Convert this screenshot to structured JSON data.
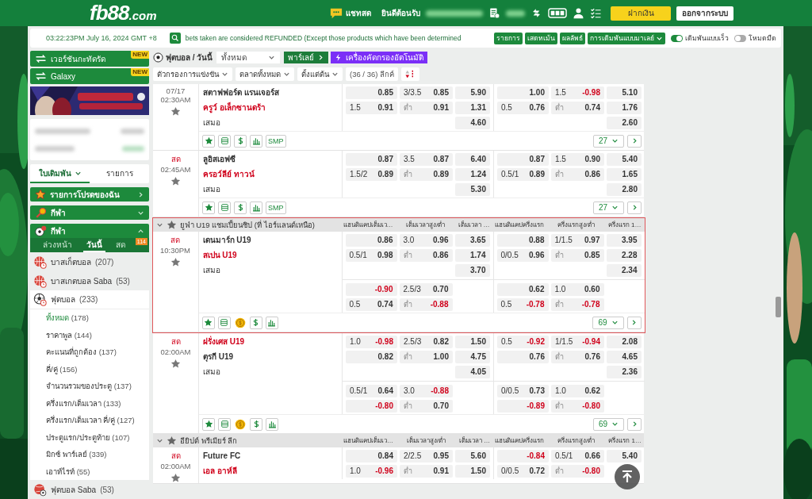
{
  "header": {
    "logo_main": "fb88",
    "logo_suffix": ".com",
    "chat": "แชทสด",
    "welcome": "ยินดีต้อนรับ",
    "deposit": "ฝากเงิน",
    "logout": "ออกจากระบบ"
  },
  "topbar": {
    "clock": "03:22:23PM July 16, 2024 GMT +8",
    "notice": "bets taken are considered REFUNDED (Except those products which have been determined",
    "links": [
      "รายการ",
      "เสตทเม้น",
      "ผลลัพธ์"
    ],
    "odds_type": "การเดิมพันแบบมาเลย์",
    "toggles": [
      {
        "label": "เดิมพันแบบเร็ว",
        "on": true
      },
      {
        "label": "โหมดมืด",
        "on": false
      }
    ]
  },
  "sidebar": {
    "promos": [
      {
        "label": "เวอร์ชันกะทัดรัด",
        "badge": "NEW"
      },
      {
        "label": "Galaxy",
        "badge": "NEW"
      }
    ],
    "slip_tabs": [
      {
        "label": "ใบเดิมพัน",
        "selected": true
      },
      {
        "label": "รายการ",
        "selected": false
      }
    ],
    "sections": [
      {
        "kind": "favorites",
        "label": "รายการโปรดของฉัน",
        "expanded": false
      },
      {
        "kind": "sports",
        "label": "กีฬา",
        "expanded": false
      },
      {
        "kind": "sports",
        "label": "กีฬา",
        "expanded": true
      }
    ],
    "periods": [
      {
        "label": "ล่วงหน้า",
        "selected": false
      },
      {
        "label": "วันนี้",
        "selected": true
      },
      {
        "label": "สด",
        "selected": false,
        "badge": "114"
      }
    ],
    "sports": [
      {
        "kind": "basketball",
        "label": "บาสเก็ตบอล",
        "count": "(207)",
        "expanded": false
      },
      {
        "kind": "basketball",
        "label": "บาสเกตบอล Saba",
        "count": "(53)",
        "expanded": false
      },
      {
        "kind": "soccer",
        "label": "ฟุตบอล",
        "count": "(233)",
        "expanded": true,
        "children": [
          {
            "label": "ทั้งหมด",
            "count": "(178)",
            "selected": true
          },
          {
            "label": "ราคาพูล",
            "count": "(144)",
            "selected": false
          },
          {
            "label": "คะแนนที่ถูกต้อง",
            "count": "(137)",
            "selected": false
          },
          {
            "label": "คี่/คู่",
            "count": "(156)",
            "selected": false
          },
          {
            "label": "จำนวนรวมของประตู",
            "count": "(137)",
            "selected": false
          },
          {
            "label": "ครึ่งแรก/เต็มเวลา",
            "count": "(133)",
            "selected": false
          },
          {
            "label": "ครึ่งแรก/เต็มเวลา คี่/คู่",
            "count": "(127)",
            "selected": false
          },
          {
            "label": "ประตูแรก/ประตูท้าย",
            "count": "(107)",
            "selected": false
          },
          {
            "label": "มิกซ์ พาร์เลย์",
            "count": "(339)",
            "selected": false
          },
          {
            "label": "เอาท์ไรท์",
            "count": "(55)",
            "selected": false
          }
        ]
      },
      {
        "kind": "saba-soccer",
        "label": "ฟุตบอล Saba",
        "count": "(53)",
        "expanded": false
      }
    ]
  },
  "main": {
    "sport_title": "ฟุตบอล / วันนี้",
    "market_select": "ทั้งหมด",
    "parlay": "พาร์เลย์",
    "auto_filter": "เครื่องคัดกรองอัตโนมัติ",
    "filters": [
      "ตัวกรองการแข่งขัน",
      "ตลาดทั้งหมด",
      "ตั้งแต่ต้น"
    ],
    "league_count": "(36 / 36) ลีกค์",
    "leagues": [
      {
        "highlighted": false,
        "matches": [
          {
            "date": "07/17",
            "time": "02:30AM",
            "home": {
              "name": "สตาฟฟอร์ด แรนเจอร์ส",
              "favorite": false
            },
            "away": {
              "name": "ครูว์ อเล็กซานดร้า",
              "favorite": true
            },
            "draw": "เสมอ",
            "rows": [
              {
                "ft_hdp": {
                  "price": "0.85",
                  "negative": false
                },
                "ft_ou": {
                  "line": "3/3.5",
                  "price": "0.85",
                  "negative": false
                },
                "ft_1x2": {
                  "price": "5.90",
                  "negative": false
                },
                "ht_hdp": {
                  "price": "1.00",
                  "negative": false
                },
                "ht_ou": {
                  "line": "1.5",
                  "price": "-0.98",
                  "negative": true
                },
                "ht_1x2": {
                  "price": "5.10",
                  "negative": false
                }
              },
              {
                "ft_hdp": {
                  "line": "1.5",
                  "price": "0.91",
                  "negative": false
                },
                "ft_ou": {
                  "line": "ต่ำ",
                  "price": "0.91",
                  "negative": false
                },
                "ft_1x2": {
                  "price": "1.31",
                  "negative": false
                },
                "ht_hdp": {
                  "line": "0.5",
                  "price": "0.76",
                  "negative": false
                },
                "ht_ou": {
                  "line": "ต่ำ",
                  "price": "0.74",
                  "negative": false
                },
                "ht_1x2": {
                  "price": "1.76",
                  "negative": false
                }
              },
              {
                "ft_1x2": {
                  "price": "4.60",
                  "negative": false
                },
                "ht_1x2": {
                  "price": "2.60",
                  "negative": false
                }
              }
            ],
            "tools": [
              {
                "kind": "star"
              },
              {
                "kind": "ticket"
              },
              {
                "kind": "dollar"
              },
              {
                "kind": "stats"
              },
              {
                "kind": "text",
                "label": "SMP"
              }
            ],
            "markets": "27"
          },
          {
            "status": "สด",
            "time": "02:45AM",
            "home": {
              "name": "ลูอิสเอฟซี",
              "favorite": false
            },
            "away": {
              "name": "ครอว์ลีย์ ทาวน์",
              "favorite": true
            },
            "draw": "เสมอ",
            "rows": [
              {
                "ft_hdp": {
                  "price": "0.87",
                  "negative": false
                },
                "ft_ou": {
                  "line": "3.5",
                  "price": "0.87",
                  "negative": false
                },
                "ft_1x2": {
                  "price": "6.40",
                  "negative": false
                },
                "ht_hdp": {
                  "price": "0.87",
                  "negative": false
                },
                "ht_ou": {
                  "line": "1.5",
                  "price": "0.90",
                  "negative": false
                },
                "ht_1x2": {
                  "price": "5.40",
                  "negative": false
                }
              },
              {
                "ft_hdp": {
                  "line": "1.5/2",
                  "price": "0.89",
                  "negative": false
                },
                "ft_ou": {
                  "line": "ต่ำ",
                  "price": "0.89",
                  "negative": false
                },
                "ft_1x2": {
                  "price": "1.24",
                  "negative": false
                },
                "ht_hdp": {
                  "line": "0.5/1",
                  "price": "0.89",
                  "negative": false
                },
                "ht_ou": {
                  "line": "ต่ำ",
                  "price": "0.86",
                  "negative": false
                },
                "ht_1x2": {
                  "price": "1.65",
                  "negative": false
                }
              },
              {
                "ft_1x2": {
                  "price": "5.30",
                  "negative": false
                },
                "ht_1x2": {
                  "price": "2.80",
                  "negative": false
                }
              }
            ],
            "tools": [
              {
                "kind": "star"
              },
              {
                "kind": "ticket"
              },
              {
                "kind": "dollar"
              },
              {
                "kind": "stats"
              },
              {
                "kind": "text",
                "label": "SMP"
              }
            ],
            "markets": "27"
          }
        ]
      },
      {
        "name": "ยูฟ่า U19 แชมเปี้ยนชิป (ที่ ไอร์แลนด์เหนือ)",
        "highlighted": true,
        "columns": [
          "แฮนดิแคปเต็มเว…",
          "เต็มเวลาสูง/ต่ำ",
          "เต็มเวลา …",
          "แฮนดิแคปครึ่งแรก",
          "ครึ่งแรกสูง/ต่ำ",
          "ครึ่งแรก 1…"
        ],
        "matches": [
          {
            "status": "สด",
            "time": "10:30PM",
            "home": {
              "name": "เดนมาร์ก U19",
              "favorite": false
            },
            "away": {
              "name": "สเปน U19",
              "favorite": true
            },
            "draw": "เสมอ",
            "rows": [
              {
                "ft_hdp": {
                  "price": "0.86",
                  "negative": false
                },
                "ft_ou": {
                  "line": "3.0",
                  "price": "0.96",
                  "negative": false
                },
                "ft_1x2": {
                  "price": "3.65",
                  "negative": false
                },
                "ht_hdp": {
                  "price": "0.88",
                  "negative": false
                },
                "ht_ou": {
                  "line": "1/1.5",
                  "price": "0.97",
                  "negative": false
                },
                "ht_1x2": {
                  "price": "3.95",
                  "negative": false
                }
              },
              {
                "ft_hdp": {
                  "line": "0.5/1",
                  "price": "0.98",
                  "negative": false
                },
                "ft_ou": {
                  "line": "ต่ำ",
                  "price": "0.86",
                  "negative": false
                },
                "ft_1x2": {
                  "price": "1.74",
                  "negative": false
                },
                "ht_hdp": {
                  "line": "0/0.5",
                  "price": "0.96",
                  "negative": false
                },
                "ht_ou": {
                  "line": "ต่ำ",
                  "price": "0.85",
                  "negative": false
                },
                "ht_1x2": {
                  "price": "2.28",
                  "negative": false
                }
              },
              {
                "ft_1x2": {
                  "price": "3.70",
                  "negative": false
                },
                "ht_1x2": {
                  "price": "2.34",
                  "negative": false
                }
              }
            ],
            "extra": [
              {
                "ft_hdp": {
                  "price": "-0.90",
                  "negative": true
                },
                "ft_ou": {
                  "line": "2.5/3",
                  "price": "0.70",
                  "negative": false
                },
                "ht_hdp": {
                  "price": "0.62",
                  "negative": false
                },
                "ht_ou": {
                  "line": "1.0",
                  "price": "0.60",
                  "negative": false
                }
              },
              {
                "ft_hdp": {
                  "line": "0.5",
                  "price": "0.74",
                  "negative": false
                },
                "ft_ou": {
                  "line": "ต่ำ",
                  "price": "-0.88",
                  "negative": true
                },
                "ht_hdp": {
                  "line": "0.5",
                  "price": "-0.78",
                  "negative": true
                },
                "ht_ou": {
                  "line": "ต่ำ",
                  "price": "-0.78",
                  "negative": true
                }
              }
            ],
            "tools": [
              {
                "kind": "star"
              },
              {
                "kind": "ticket"
              },
              {
                "kind": "coin"
              },
              {
                "kind": "dollar"
              },
              {
                "kind": "stats"
              }
            ],
            "markets": "69"
          },
          {
            "status": "สด",
            "time": "02:00AM",
            "home": {
              "name": "ฝรั่งเศส U19",
              "favorite": true
            },
            "away": {
              "name": "ตุรกี U19",
              "favorite": false
            },
            "draw": "เสมอ",
            "rows": [
              {
                "ft_hdp": {
                  "line": "1.0",
                  "price": "-0.98",
                  "negative": true
                },
                "ft_ou": {
                  "line": "2.5/3",
                  "price": "0.82",
                  "negative": false
                },
                "ft_1x2": {
                  "price": "1.50",
                  "negative": false
                },
                "ht_hdp": {
                  "line": "0.5",
                  "price": "-0.92",
                  "negative": true
                },
                "ht_ou": {
                  "line": "1/1.5",
                  "price": "-0.94",
                  "negative": true
                },
                "ht_1x2": {
                  "price": "2.08",
                  "negative": false
                }
              },
              {
                "ft_hdp": {
                  "price": "0.82",
                  "negative": false
                },
                "ft_ou": {
                  "line": "ต่ำ",
                  "price": "1.00",
                  "negative": false
                },
                "ft_1x2": {
                  "price": "4.75",
                  "negative": false
                },
                "ht_hdp": {
                  "price": "0.76",
                  "negative": false
                },
                "ht_ou": {
                  "line": "ต่ำ",
                  "price": "0.76",
                  "negative": false
                },
                "ht_1x2": {
                  "price": "4.65",
                  "negative": false
                }
              },
              {
                "ft_1x2": {
                  "price": "4.05",
                  "negative": false
                },
                "ht_1x2": {
                  "price": "2.36",
                  "negative": false
                }
              }
            ],
            "extra": [
              {
                "ft_hdp": {
                  "line": "0.5/1",
                  "price": "0.64",
                  "negative": false
                },
                "ft_ou": {
                  "line": "3.0",
                  "price": "-0.88",
                  "negative": true
                },
                "ht_hdp": {
                  "line": "0/0.5",
                  "price": "0.73",
                  "negative": false
                },
                "ht_ou": {
                  "line": "1.0",
                  "price": "0.62",
                  "negative": false
                }
              },
              {
                "ft_hdp": {
                  "price": "-0.80",
                  "negative": true
                },
                "ft_ou": {
                  "line": "ต่ำ",
                  "price": "0.70",
                  "negative": false
                },
                "ht_hdp": {
                  "price": "-0.89",
                  "negative": true
                },
                "ht_ou": {
                  "line": "ต่ำ",
                  "price": "-0.80",
                  "negative": true
                }
              }
            ],
            "tools": [
              {
                "kind": "star"
              },
              {
                "kind": "ticket"
              },
              {
                "kind": "coin"
              },
              {
                "kind": "dollar"
              },
              {
                "kind": "stats"
              }
            ],
            "markets": "69"
          }
        ]
      },
      {
        "name": "อียิปต์ พรีเมียร์ ลีก",
        "highlighted": false,
        "columns": [
          "แฮนดิแคปเต็มเว…",
          "เต็มเวลาสูง/ต่ำ",
          "เต็มเวลา …",
          "แฮนดิแคปครึ่งแรก",
          "ครึ่งแรกสูง/ต่ำ",
          "ครึ่งแรก 1…"
        ],
        "matches": [
          {
            "status": "สด",
            "time": "02:00AM",
            "home": {
              "name": "Future FC",
              "favorite": false
            },
            "away": {
              "name": "เอล อาห์ลี",
              "favorite": true
            },
            "rows": [
              {
                "ft_hdp": {
                  "price": "0.84",
                  "negative": false
                },
                "ft_ou": {
                  "line": "2/2.5",
                  "price": "0.95",
                  "negative": false
                },
                "ft_1x2": {
                  "price": "5.60",
                  "negative": false
                },
                "ht_hdp": {
                  "price": "-0.84",
                  "negative": true
                },
                "ht_ou": {
                  "line": "0.5/1",
                  "price": "0.66",
                  "negative": false
                },
                "ht_1x2": {
                  "price": "5.40",
                  "negative": false
                }
              },
              {
                "ft_hdp": {
                  "line": "1.0",
                  "price": "-0.96",
                  "negative": true
                },
                "ft_ou": {
                  "line": "ต่ำ",
                  "price": "0.91",
                  "negative": false
                },
                "ft_1x2": {
                  "price": "1.50",
                  "negative": false
                },
                "ht_hdp": {
                  "line": "0/0.5",
                  "price": "0.72",
                  "negative": false
                },
                "ht_ou": {
                  "line": "ต่ำ",
                  "price": "-0.80",
                  "negative": true
                }
              }
            ]
          }
        ]
      }
    ]
  }
}
